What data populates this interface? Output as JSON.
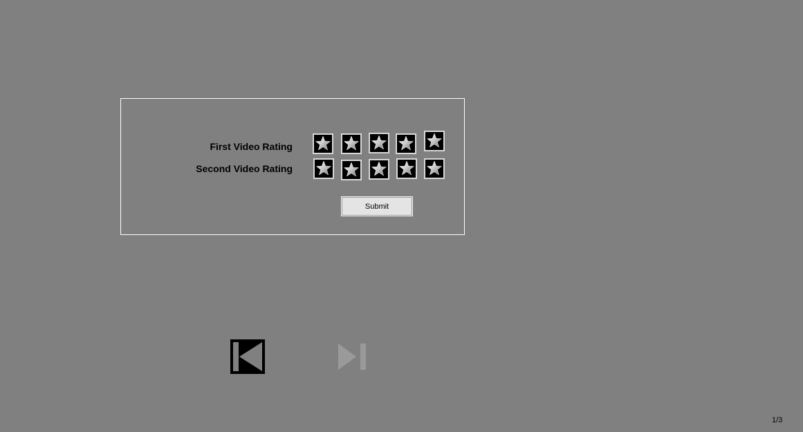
{
  "rating_form": {
    "rows": [
      {
        "label": "First Video Rating",
        "max_stars": 5
      },
      {
        "label": "Second Video Rating",
        "max_stars": 5
      }
    ],
    "submit_label": "Submit"
  },
  "navigation": {
    "previous_icon": "skip-previous-icon",
    "next_icon": "skip-next-icon",
    "next_enabled": false
  },
  "page_indicator": "1/3",
  "colors": {
    "background": "#808080",
    "panel_border": "#ffffff",
    "star_tile": "#000000",
    "next_disabled": "#9a9a9a"
  }
}
